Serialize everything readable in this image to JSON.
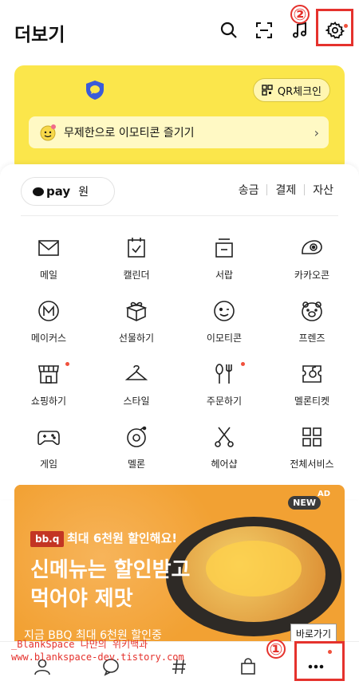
{
  "header": {
    "title": "더보기",
    "icons": [
      "search-icon",
      "scan-icon",
      "music-icon",
      "gear-icon"
    ],
    "annotation_two": "②"
  },
  "yellow_card": {
    "qr_label": "QR체크인",
    "emoticon_banner": "무제한으로 이모티콘 즐기기",
    "chevron": "›"
  },
  "pay": {
    "brand": "pay",
    "balance_unit": "원",
    "actions": [
      "송금",
      "결제",
      "자산"
    ]
  },
  "services": [
    {
      "label": "메일",
      "icon": "mail-icon",
      "dot": false
    },
    {
      "label": "캘린더",
      "icon": "calendar-icon",
      "dot": false
    },
    {
      "label": "서랍",
      "icon": "drawer-icon",
      "dot": false
    },
    {
      "label": "카카오콘",
      "icon": "kakaocon-icon",
      "dot": false
    },
    {
      "label": "메이커스",
      "icon": "makers-icon",
      "dot": false
    },
    {
      "label": "선물하기",
      "icon": "gift-icon",
      "dot": false
    },
    {
      "label": "이모티콘",
      "icon": "emoticon-icon",
      "dot": false
    },
    {
      "label": "프렌즈",
      "icon": "friends-icon",
      "dot": false
    },
    {
      "label": "쇼핑하기",
      "icon": "shop-icon",
      "dot": true
    },
    {
      "label": "스타일",
      "icon": "hanger-icon",
      "dot": false
    },
    {
      "label": "주문하기",
      "icon": "utensils-icon",
      "dot": true
    },
    {
      "label": "멜론티켓",
      "icon": "ticket-icon",
      "dot": false
    },
    {
      "label": "게임",
      "icon": "gamepad-icon",
      "dot": false
    },
    {
      "label": "멜론",
      "icon": "melon-icon",
      "dot": false
    },
    {
      "label": "헤어샵",
      "icon": "scissors-icon",
      "dot": false
    },
    {
      "label": "전체서비스",
      "icon": "grid-icon",
      "dot": false
    }
  ],
  "ad": {
    "bbq_logo": "bb.q",
    "top_line": "최대 6천원 할인해요!",
    "headline1": "신메뉴는 할인받고",
    "headline2": "먹어야 제맛",
    "bottom_line": "지금 BBQ 최대 6천원 할인중",
    "cta": "바로가기",
    "new_tag": "NEW",
    "ad_tag": "AD"
  },
  "watermark": {
    "line1": "_BlankSpace 나만의 위키백과",
    "line2": "www.blankspace-dev.tistory.com"
  },
  "bottom_nav": {
    "items": [
      "friends-icon",
      "chat-icon",
      "hashtag-icon",
      "shopping-bag-icon",
      "more-icon"
    ],
    "annotation_one": "①"
  },
  "colors": {
    "kakao_yellow": "#fbe64b",
    "annotation_red": "#e5322d",
    "notification_dot": "#f0503c",
    "ad_orange": "#f2a133"
  }
}
